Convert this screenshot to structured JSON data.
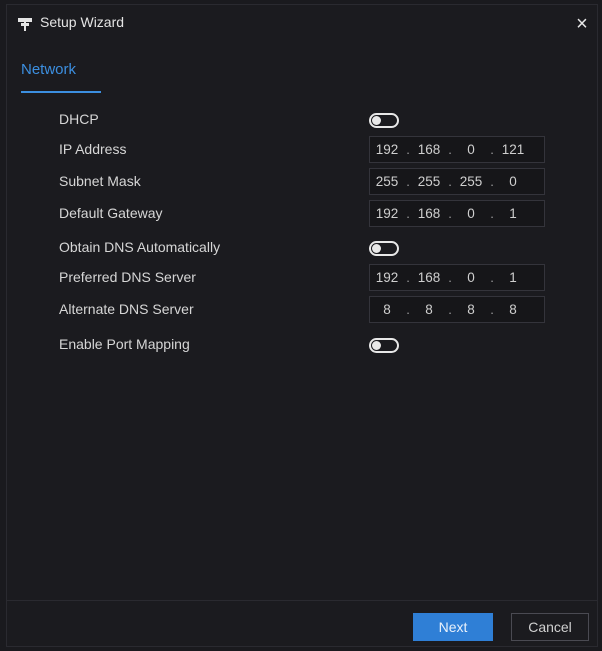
{
  "window": {
    "title": "Setup Wizard",
    "close_label": "×"
  },
  "tabs": [
    {
      "label": "Network",
      "active": true
    }
  ],
  "fields": {
    "dhcp": {
      "label": "DHCP",
      "enabled": false
    },
    "ip_address": {
      "label": "IP Address",
      "octets": [
        "192",
        "168",
        "0",
        "121"
      ]
    },
    "subnet_mask": {
      "label": "Subnet Mask",
      "octets": [
        "255",
        "255",
        "255",
        "0"
      ]
    },
    "default_gateway": {
      "label": "Default Gateway",
      "octets": [
        "192",
        "168",
        "0",
        "1"
      ]
    },
    "obtain_dns": {
      "label": "Obtain DNS Automatically",
      "enabled": false
    },
    "preferred_dns": {
      "label": "Preferred DNS Server",
      "octets": [
        "192",
        "168",
        "0",
        "1"
      ]
    },
    "alternate_dns": {
      "label": "Alternate DNS Server",
      "octets": [
        "8",
        "8",
        "8",
        "8"
      ]
    },
    "port_mapping": {
      "label": "Enable Port Mapping",
      "enabled": false
    }
  },
  "buttons": {
    "next_label": "Next",
    "cancel_label": "Cancel"
  },
  "colors": {
    "accent": "#3c8fe0",
    "background": "#1b1b1f",
    "primary_button": "#2f7fd6"
  },
  "icons": {
    "title_icon": "wizard-sign-icon",
    "close_icon": "close-icon"
  }
}
